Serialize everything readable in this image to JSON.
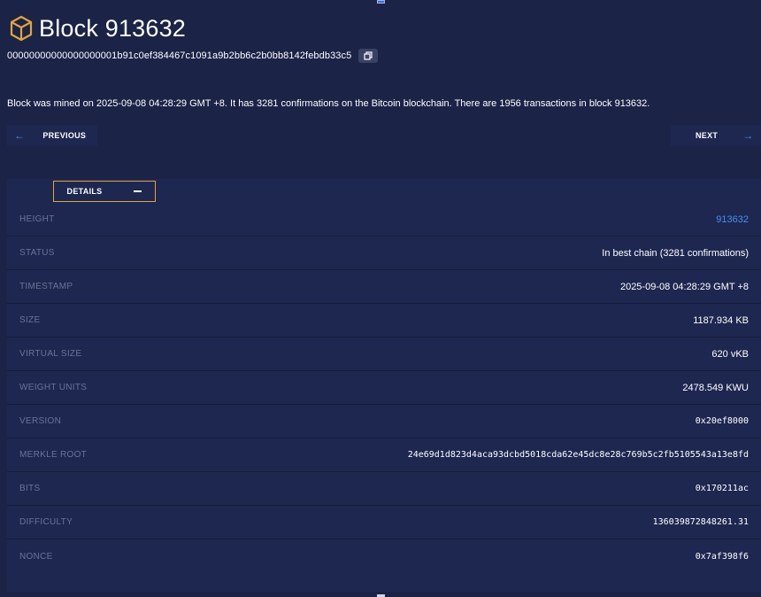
{
  "block": {
    "title": "Block 913632",
    "hash": "00000000000000000001b91c0ef384467c1091a9b2bb6c2b0bb8142febdb33c5",
    "summary": "Block was mined on 2025-09-08 04:28:29 GMT +8. It has 3281 confirmations on the Bitcoin blockchain. There are 1956 transactions in block 913632."
  },
  "nav": {
    "previous_label": "PREVIOUS",
    "next_label": "NEXT"
  },
  "details": {
    "tab_label": "DETAILS",
    "rows": [
      {
        "label": "HEIGHT",
        "value": "913632"
      },
      {
        "label": "STATUS",
        "value": "In best chain (3281 confirmations)"
      },
      {
        "label": "TIMESTAMP",
        "value": "2025-09-08 04:28:29 GMT +8"
      },
      {
        "label": "SIZE",
        "value": "1187.934 KB"
      },
      {
        "label": "VIRTUAL SIZE",
        "value": "620 vKB"
      },
      {
        "label": "WEIGHT UNITS",
        "value": "2478.549 KWU"
      },
      {
        "label": "VERSION",
        "value": "0x20ef8000"
      },
      {
        "label": "MERKLE ROOT",
        "value": "24e69d1d823d4aca93dcbd5018cda62e45dc8e28c769b5c2fb5105543a13e8fd"
      },
      {
        "label": "BITS",
        "value": "0x170211ac"
      },
      {
        "label": "DIFFICULTY",
        "value": "136039872848261.31"
      },
      {
        "label": "NONCE",
        "value": "0x7af398f6"
      }
    ]
  },
  "icons": {
    "title_icon": "cube-icon",
    "copy_icon": "copy-icon",
    "prev_icon": "arrow-left-icon",
    "next_icon": "arrow-right-icon",
    "collapse_icon": "minus-icon"
  },
  "colors": {
    "background": "#1b2347",
    "panel": "#1e2750",
    "accent_gold": "#e0a63a",
    "link_blue": "#4a8ef0",
    "label_gray": "#6a7397"
  }
}
